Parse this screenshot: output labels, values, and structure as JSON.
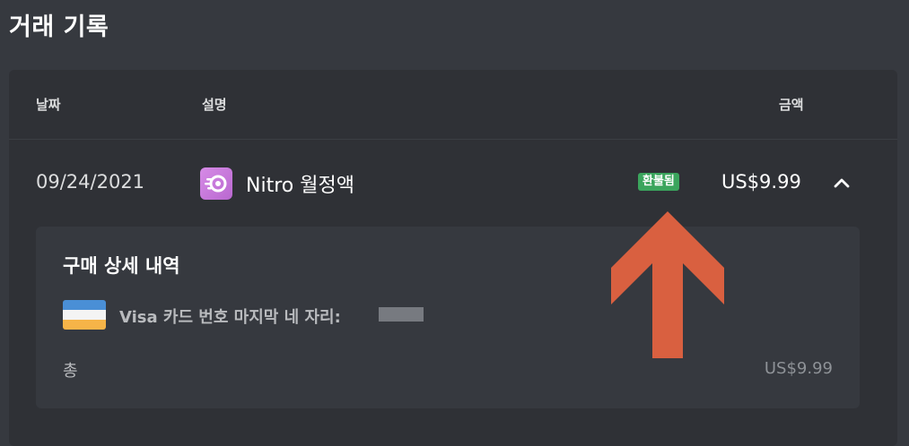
{
  "page": {
    "title": "거래 기록"
  },
  "table": {
    "headers": {
      "date": "날짜",
      "description": "설명",
      "amount": "금액"
    },
    "rows": [
      {
        "date": "09/24/2021",
        "icon": "nitro-icon",
        "description": "Nitro 월정액",
        "status": "환불됨",
        "amount": "US$9.99",
        "expanded": true
      }
    ]
  },
  "details": {
    "title": "구매 상세 내역",
    "payment_icon": "card-icon",
    "payment_text": "Visa 카드 번호 마지막 네 자리:",
    "total_label": "총",
    "total_value": "US$9.99"
  },
  "annotation": {
    "icon": "arrow-up-icon",
    "color": "#d96040"
  },
  "colors": {
    "background": "#36393f",
    "panel": "#2f3136",
    "badge_green": "#3ba55d",
    "nitro_purple": "#c27ddc"
  }
}
